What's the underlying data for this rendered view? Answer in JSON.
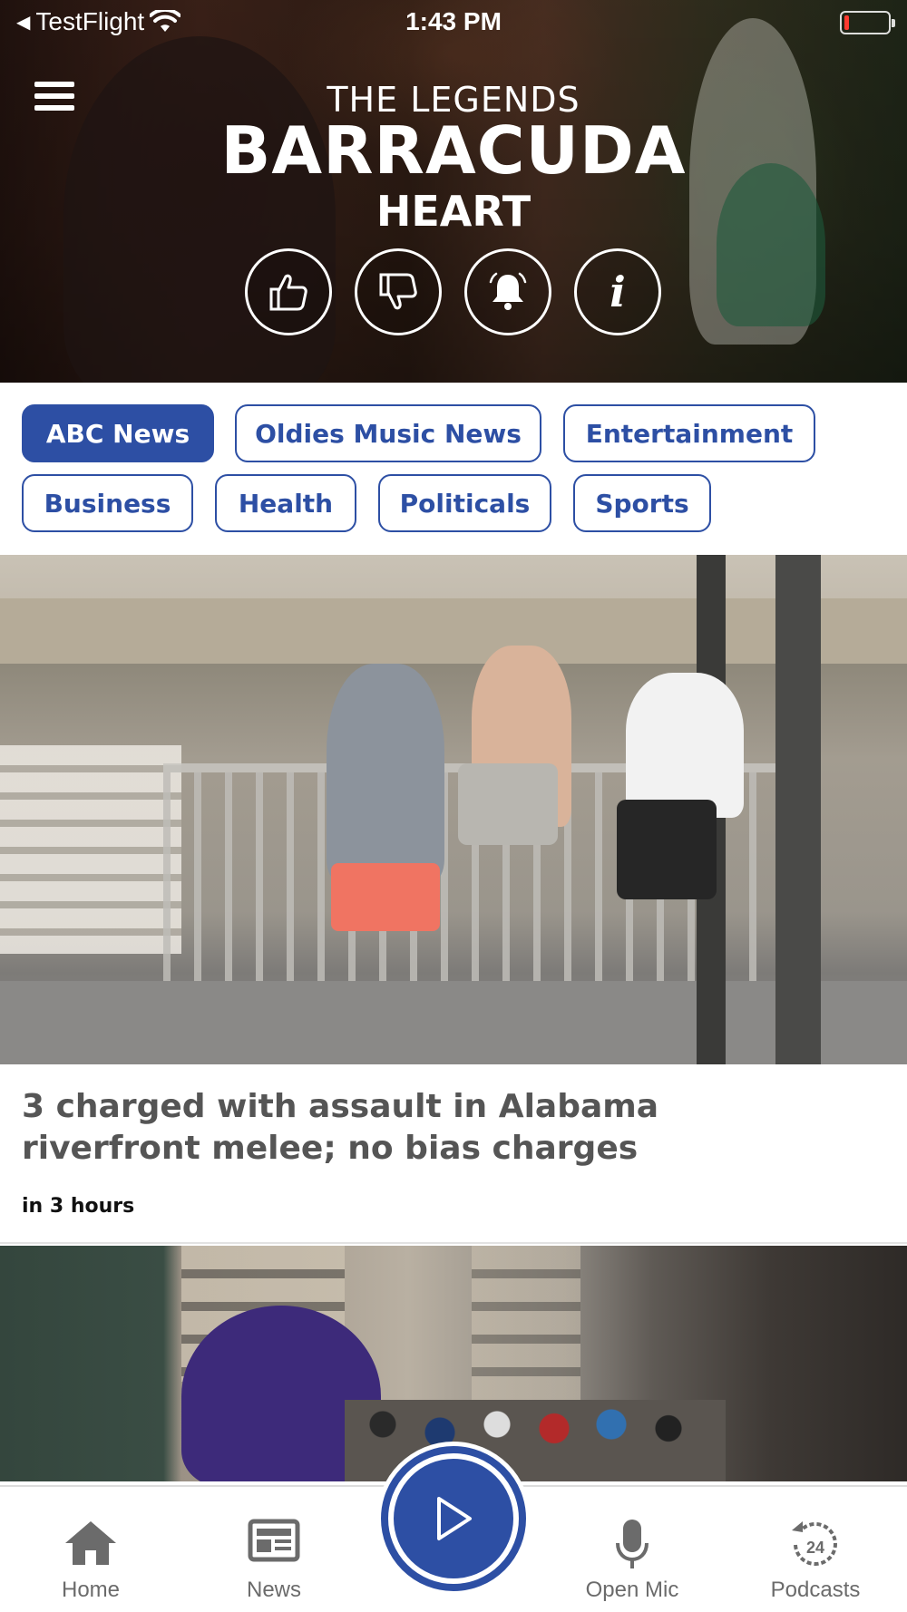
{
  "status_bar": {
    "back_app": "TestFlight",
    "time": "1:43 PM"
  },
  "now_playing": {
    "station": "THE LEGENDS",
    "song": "BARRACUDA",
    "artist": "HEART"
  },
  "actions": {
    "like_icon": "thumbs-up-icon",
    "dislike_icon": "thumbs-down-icon",
    "alert_icon": "bell-icon",
    "info_label": "i"
  },
  "categories": [
    {
      "label": "ABC News",
      "active": true
    },
    {
      "label": "Oldies Music News",
      "active": false
    },
    {
      "label": "Entertainment",
      "active": false
    },
    {
      "label": "Business",
      "active": false
    },
    {
      "label": "Health",
      "active": false
    },
    {
      "label": "Politicals",
      "active": false
    },
    {
      "label": "Sports",
      "active": false
    }
  ],
  "stories": [
    {
      "title": "3 charged with assault in Alabama riverfront melee; no bias charges",
      "time": "in 3 hours"
    }
  ],
  "tabbar": {
    "home": "Home",
    "news": "News",
    "play_icon": "play-icon",
    "open_mic": "Open Mic",
    "podcasts": "Podcasts",
    "podcasts_badge": "24"
  },
  "colors": {
    "accent": "#2d4fa4",
    "tab_label": "#6b6b6b",
    "story_title": "#555555"
  }
}
